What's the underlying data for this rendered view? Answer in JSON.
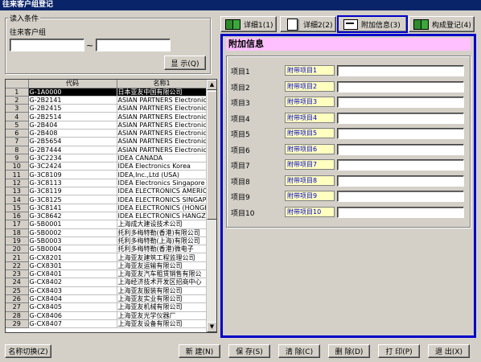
{
  "window": {
    "title": "往来客户组登记"
  },
  "filter": {
    "legend": "读入条件",
    "field_label": "往来客户组",
    "from_value": "",
    "to_value": "",
    "range_sep": "~",
    "show_button": "显  示(Q)"
  },
  "tabs": [
    {
      "label": "详细1(1)",
      "icon": "book-icon"
    },
    {
      "label": "详细2(2)",
      "icon": "document-icon"
    },
    {
      "label": "附加信息(3)",
      "icon": "info-card-icon",
      "active": true
    },
    {
      "label": "构成登记(4)",
      "icon": "book-icon"
    }
  ],
  "grid": {
    "columns": [
      "",
      "代码",
      "名称1"
    ],
    "selected_row": 1,
    "rows": [
      [
        "1",
        "G-1A0000",
        "日本亚友中国有限公司"
      ],
      [
        "2",
        "G-2B2141",
        "ASIAN PARTNERS Electronics"
      ],
      [
        "3",
        "G-2B2415",
        "ASIAN PARTNERS Electronics"
      ],
      [
        "4",
        "G-2B2514",
        "ASIAN PARTNERS Electronics"
      ],
      [
        "5",
        "G-2B404",
        "ASIAN PARTNERS Electronics"
      ],
      [
        "6",
        "G-2B408",
        "ASIAN PARTNERS Electronics"
      ],
      [
        "7",
        "G-2B5654",
        "ASIAN PARTNERS Electronics"
      ],
      [
        "8",
        "G-2B7444",
        "ASIAN PARTNERS Electronics"
      ],
      [
        "9",
        "G-3C2234",
        "IDEA CANADA"
      ],
      [
        "10",
        "G-3C2424",
        "IDEA Electronics Korea"
      ],
      [
        "11",
        "G-3C8109",
        "IDEA,Inc.,Ltd (USA)"
      ],
      [
        "12",
        "G-3C8113",
        "IDEA Electronics Singapore"
      ],
      [
        "13",
        "G-3C8119",
        "IDEA ELECTRONICS AMERICA I"
      ],
      [
        "14",
        "G-3C8125",
        "IDEA ELECTRONICS SINGAPORE"
      ],
      [
        "15",
        "G-3C8141",
        "IDEA ELECTRONICS (HONGKONG"
      ],
      [
        "16",
        "G-3C8642",
        "IDEA ELECTRONICS HANGZHOU"
      ],
      [
        "17",
        "G-5B0001",
        "上海成大建设技术公司"
      ],
      [
        "18",
        "G-5B0002",
        "托利多梅特勒(香港)有限公司"
      ],
      [
        "19",
        "G-5B0003",
        "托利多梅特勒(上海)有限公司"
      ],
      [
        "20",
        "G-5B0004",
        "托利多梅特勒(香港)微电子"
      ],
      [
        "21",
        "G-CX8201",
        "上海亚友建筑工程监理公司"
      ],
      [
        "22",
        "G-CX8301",
        "上海亚友运输有限公司"
      ],
      [
        "23",
        "G-CX8401",
        "上海亚友汽车租赁销售有限公"
      ],
      [
        "24",
        "G-CX8402",
        "上海经济技术开发区招商中心"
      ],
      [
        "25",
        "G-CX8403",
        "上海亚友服装有限公司"
      ],
      [
        "26",
        "G-CX8404",
        "上海亚友实业有限公司"
      ],
      [
        "27",
        "G-CX8405",
        "上海亚友机械有限公司"
      ],
      [
        "28",
        "G-CX8406",
        "上海亚友光学仪器厂"
      ],
      [
        "29",
        "G-CX8407",
        "上海亚友设备有限公司"
      ]
    ]
  },
  "panel": {
    "header": "附加信息",
    "items": [
      {
        "label": "项目1",
        "tag": "附带项目1",
        "value": ""
      },
      {
        "label": "项目2",
        "tag": "附带项目2",
        "value": ""
      },
      {
        "label": "项目3",
        "tag": "附带项目3",
        "value": ""
      },
      {
        "label": "项目4",
        "tag": "附带项目4",
        "value": ""
      },
      {
        "label": "项目5",
        "tag": "附带项目5",
        "value": ""
      },
      {
        "label": "项目6",
        "tag": "附带项目6",
        "value": ""
      },
      {
        "label": "项目7",
        "tag": "附带项目7",
        "value": ""
      },
      {
        "label": "项目8",
        "tag": "附带项目8",
        "value": ""
      },
      {
        "label": "项目9",
        "tag": "附带项目9",
        "value": ""
      },
      {
        "label": "项目10",
        "tag": "附带项目10",
        "value": ""
      }
    ]
  },
  "bottom": {
    "name_switch": "名称切换(Z)",
    "new": "新  建(N)",
    "save": "保  存(S)",
    "clear": "清  除(C)",
    "delete": "删  除(D)",
    "print": "打  印(P)",
    "exit": "退  出(X)"
  },
  "colors": {
    "titlebar": "#0a246a",
    "panel_border": "#0000c8",
    "panel_header_bg": "#ffc0ff",
    "tag_bg": "#ffffc0",
    "tag_text": "#0000c8"
  }
}
